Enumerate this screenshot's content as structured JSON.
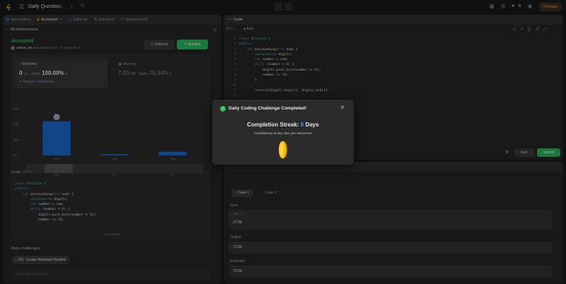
{
  "topbar": {
    "title": "Daily Question",
    "coins": "6",
    "premium": "Premium"
  },
  "left": {
    "tabs": [
      {
        "label": "Description"
      },
      {
        "label": "Accepted"
      },
      {
        "label": "Editorial"
      },
      {
        "label": "Solutions"
      },
      {
        "label": "Submissions"
      }
    ],
    "back_link": "All Submissions",
    "status": "Accepted",
    "user": "dilshar_66",
    "submitted": "submitted at Oct 17, 2024 18:37",
    "editorial_btn": "Editorial",
    "solution_btn": "Solution",
    "runtime": {
      "label": "Runtime",
      "value": "0",
      "unit": "ms",
      "beats_label": "Beats",
      "beats": "100.00%",
      "analyze": "Analyze Complexity"
    },
    "memory": {
      "label": "Memory",
      "value": "7.50",
      "unit": "MB",
      "beats_label": "Beats",
      "beats": "70.34%"
    },
    "code_header": "Code",
    "code_lang": "C++",
    "view_more": "View more",
    "more_challenges": "More challenges",
    "challenge_tag": "321. Create Maximum Number",
    "notes_placeholder": "Write your notes here"
  },
  "chart_data": {
    "type": "bar",
    "y_ticks": [
      "75%",
      "50%",
      "25%",
      "0%"
    ],
    "x_labels": [
      "",
      "0ms",
      "1ms",
      "2ms"
    ],
    "values": [
      55,
      2,
      6
    ],
    "ylim": [
      0,
      75
    ]
  },
  "editor": {
    "header": "Code",
    "lang": "C++",
    "auto": "Auto",
    "line_numbers": [
      "1",
      "2",
      "3",
      "4",
      "5",
      "6",
      "7",
      "8",
      "9",
      "10",
      "11",
      "12"
    ],
    "run": "Run",
    "submit": "Submit"
  },
  "modal": {
    "title": "Daily Coding Challenge Completed!",
    "streak_label": "Completion Streak:",
    "streak_value": "6",
    "streak_unit": "Days",
    "message": "Consistency is key, see you tomorrow!"
  },
  "testcases": {
    "cases": [
      "Case 1",
      "Case 2"
    ],
    "input_label": "Input",
    "input_var": "num =",
    "input_value": "2736",
    "output_label": "Output",
    "output_value": "7236",
    "expected_label": "Expected",
    "expected_value": "7236"
  },
  "colors": {
    "accent": "#ffa116",
    "success": "#2cbb5d",
    "bar": "#1a6bd4"
  }
}
